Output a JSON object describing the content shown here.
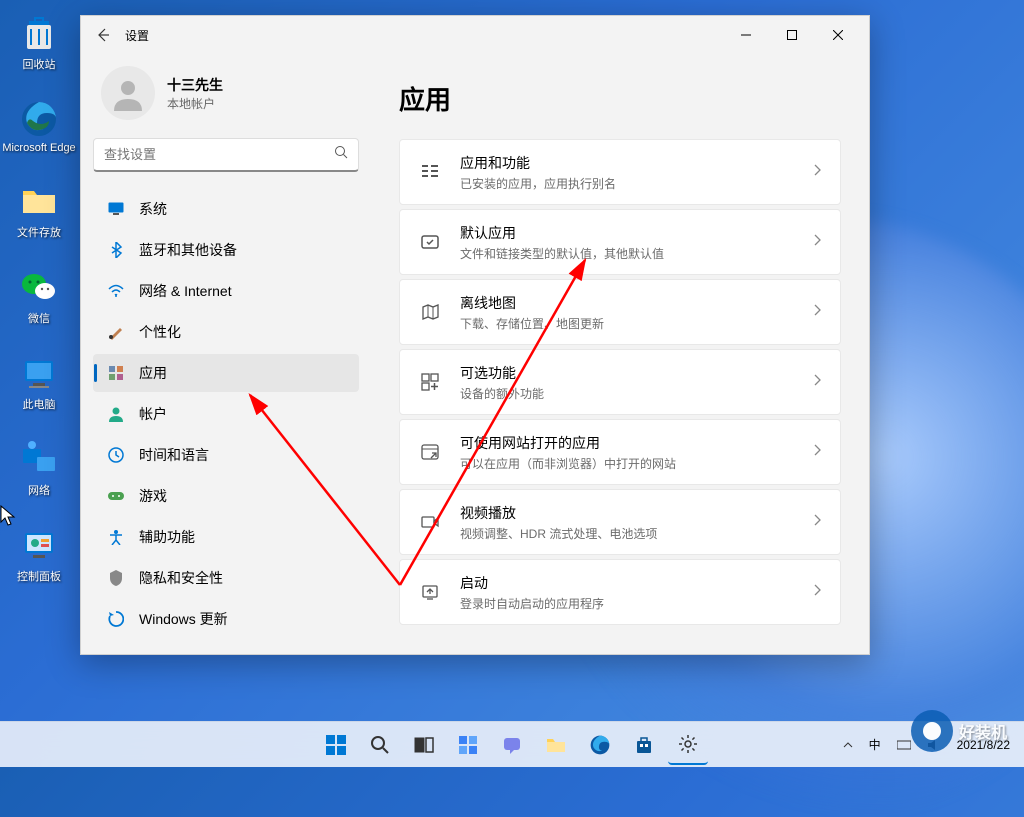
{
  "desktop": {
    "icons": [
      {
        "label": "回收站",
        "key": "recycle"
      },
      {
        "label": "Microsoft Edge",
        "key": "edge"
      },
      {
        "label": "文件存放",
        "key": "folder"
      },
      {
        "label": "微信",
        "key": "wechat"
      },
      {
        "label": "此电脑",
        "key": "thispc"
      },
      {
        "label": "网络",
        "key": "network"
      },
      {
        "label": "控制面板",
        "key": "controlpanel"
      }
    ]
  },
  "window": {
    "title": "设置",
    "user": {
      "name": "十三先生",
      "sub": "本地帐户"
    },
    "search_placeholder": "查找设置",
    "nav": [
      {
        "label": "系统",
        "icon": "system"
      },
      {
        "label": "蓝牙和其他设备",
        "icon": "bluetooth"
      },
      {
        "label": "网络 & Internet",
        "icon": "wifi"
      },
      {
        "label": "个性化",
        "icon": "personalize"
      },
      {
        "label": "应用",
        "icon": "apps",
        "selected": true
      },
      {
        "label": "帐户",
        "icon": "account"
      },
      {
        "label": "时间和语言",
        "icon": "time"
      },
      {
        "label": "游戏",
        "icon": "gaming"
      },
      {
        "label": "辅助功能",
        "icon": "accessibility"
      },
      {
        "label": "隐私和安全性",
        "icon": "privacy"
      },
      {
        "label": "Windows 更新",
        "icon": "update"
      }
    ],
    "content": {
      "heading": "应用",
      "cards": [
        {
          "title": "应用和功能",
          "sub": "已安装的应用，应用执行别名",
          "icon": "apps-features"
        },
        {
          "title": "默认应用",
          "sub": "文件和链接类型的默认值，其他默认值",
          "icon": "default-apps"
        },
        {
          "title": "离线地图",
          "sub": "下载、存储位置、地图更新",
          "icon": "maps"
        },
        {
          "title": "可选功能",
          "sub": "设备的额外功能",
          "icon": "optional"
        },
        {
          "title": "可使用网站打开的应用",
          "sub": "可以在应用（而非浏览器）中打开的网站",
          "icon": "websites"
        },
        {
          "title": "视频播放",
          "sub": "视频调整、HDR 流式处理、电池选项",
          "icon": "video"
        },
        {
          "title": "启动",
          "sub": "登录时自动启动的应用程序",
          "icon": "startup"
        }
      ]
    }
  },
  "taskbar": {
    "tray": {
      "ime": "中",
      "date": "2021/8/22"
    }
  },
  "watermark": {
    "text": "好装机"
  }
}
